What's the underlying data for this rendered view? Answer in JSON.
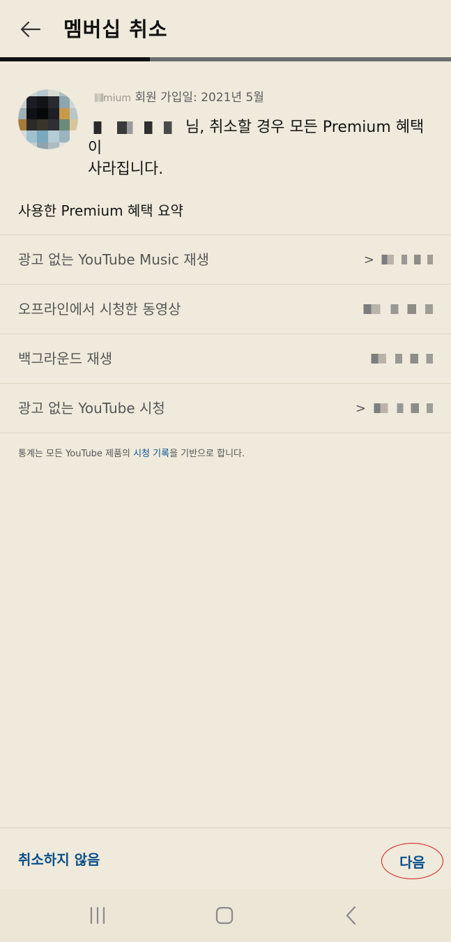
{
  "header": {
    "title": "멤버십 취소",
    "progress_fraction": 0.333
  },
  "member": {
    "join_prefix_label": "mium",
    "join_text": "회원 가입일: 2021년 5월",
    "notice_suffix": "님, 취소할 경우 모든 Premium 혜택이",
    "notice_line2": "사라집니다."
  },
  "benefits": {
    "title": "사용한 Premium 혜택 요약",
    "rows": [
      {
        "label": "광고 없는 YouTube Music 재생"
      },
      {
        "label": "오프라인에서 시청한 동영상"
      },
      {
        "label": "백그라운드 재생"
      },
      {
        "label": "광고 없는 YouTube 시청"
      }
    ],
    "value_prefix": ">"
  },
  "footnote": {
    "before": "통계는 모든 YouTube 제품의 ",
    "link": "시청 기록",
    "after": "을 기반으로 합니다."
  },
  "actions": {
    "cancel_label": "취소하지 않음",
    "next_label": "다음"
  },
  "colors": {
    "background": "#efeadb",
    "accent_link": "#0b4f8a",
    "highlight_circle": "#d11a1a",
    "progress_track": "#6b6f6f",
    "progress_fill": "#0f1113"
  },
  "icons": {
    "back": "arrow-left-icon",
    "nav_recent": "recent-apps-icon",
    "nav_home": "home-icon",
    "nav_back": "back-chevron-icon"
  }
}
